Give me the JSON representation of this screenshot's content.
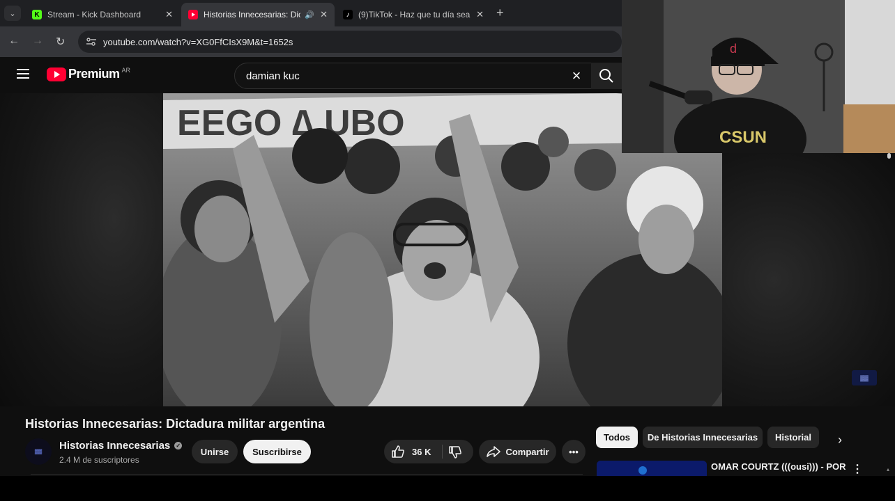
{
  "browser": {
    "tabs": [
      {
        "title": "Stream - Kick Dashboard",
        "favicon": "kick-icon",
        "active": false
      },
      {
        "title": "Historias Innecesarias: Dicta",
        "favicon": "youtube-icon",
        "active": true,
        "audio": "speaker-icon"
      },
      {
        "title": "(9)TikTok - Haz que tu día sea e",
        "favicon": "tiktok-icon",
        "active": false
      }
    ],
    "url": "youtube.com/watch?v=XG0FfCIsX9M&t=1652s"
  },
  "youtube": {
    "brand": "Premium",
    "country": "AR",
    "search_query": "damian kuc",
    "accent": "#ff0033"
  },
  "video": {
    "title": "Historias Innecesarias: Dictadura militar argentina",
    "channel": "Historias Innecesarias",
    "subscribers": "2.4 M de suscriptores",
    "join_label": "Unirse",
    "subscribe_label": "Suscribirse",
    "likes": "36 K",
    "share_label": "Compartir"
  },
  "sidebar": {
    "chips": [
      "Todos",
      "De Historias Innecesarias",
      "Historial"
    ],
    "rec_title": "OMAR COURTZ (((ousi))) - POR"
  }
}
